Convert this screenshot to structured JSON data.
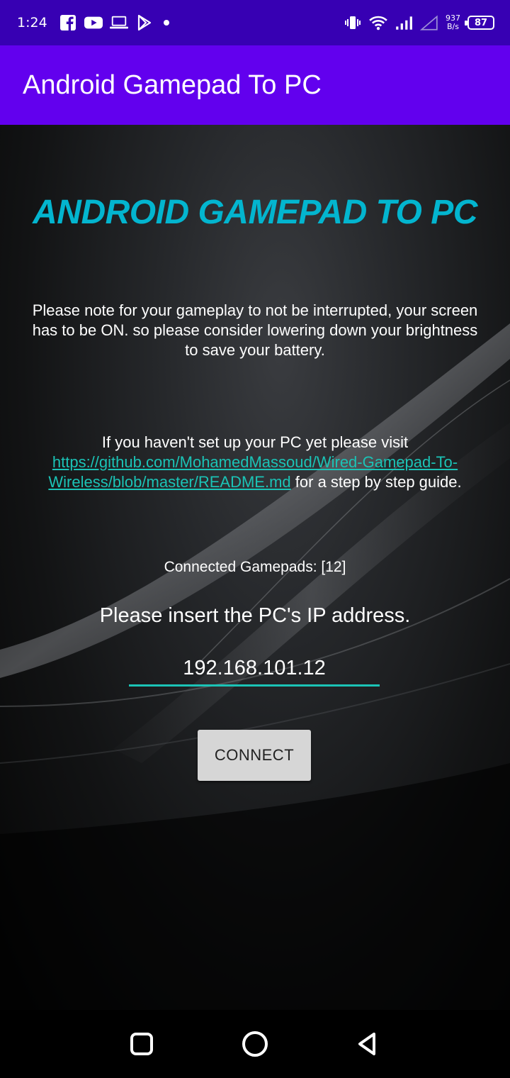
{
  "status_bar": {
    "time": "1:24",
    "net_speed_value": "937",
    "net_speed_unit": "B/s",
    "battery_level": "87",
    "left_icons": [
      "facebook-icon",
      "youtube-icon",
      "laptop-icon",
      "play-store-icon",
      "notification-dot"
    ],
    "right_icons": [
      "vibrate-icon",
      "wifi-icon",
      "signal-icon",
      "signal-empty-icon"
    ]
  },
  "app_bar": {
    "title": "Android Gamepad To PC"
  },
  "main": {
    "hero_title": "ANDROID GAMEPAD TO PC",
    "notice_text": "Please note for your gameplay to not be interrupted, your screen has to be ON. so please consider lowering down your brightness to save your battery.",
    "setup_prefix": "If you haven't set up your PC yet please visit",
    "setup_link": "https://github.com/MohamedMassoud/Wired-Gamepad-To-Wireless/blob/master/README.md",
    "setup_suffix": "for a step by step guide.",
    "connected_gamepads": "Connected Gamepads: [12]",
    "ip_prompt": "Please insert the PC's IP address.",
    "ip_value": "192.168.101.12",
    "connect_label": "CONNECT"
  },
  "nav_bar": {
    "buttons": [
      "recents-icon",
      "home-icon",
      "back-icon"
    ]
  },
  "colors": {
    "status_bar": "#3700b3",
    "app_bar": "#6200ee",
    "accent": "#03b5cf",
    "link": "#1bc3b6",
    "button_bg": "#d6d6d6"
  }
}
